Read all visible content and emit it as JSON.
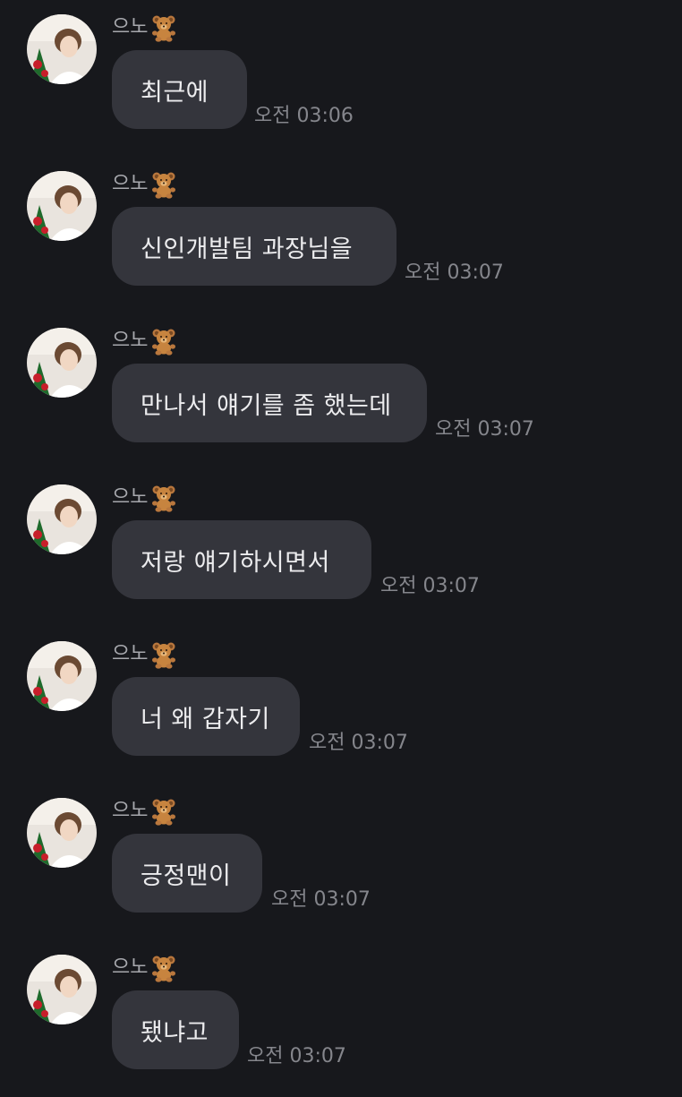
{
  "chat": {
    "sender_name": "으노",
    "sender_emoji_icon": "teddy-bear-icon",
    "avatar": "profile-photo",
    "colors": {
      "background": "#17181c",
      "bubble": "#34353c",
      "text": "#ececee",
      "meta": "#85868c"
    },
    "messages": [
      {
        "text": "최근에",
        "time": "오전 03:06"
      },
      {
        "text": "신인개발팀 과장님을",
        "time": "오전 03:07"
      },
      {
        "text": "만나서 얘기를 좀 했는데",
        "time": "오전 03:07"
      },
      {
        "text": "저랑 얘기하시면서",
        "time": "오전 03:07"
      },
      {
        "text": "너 왜 갑자기",
        "time": "오전 03:07"
      },
      {
        "text": "긍정맨이",
        "time": "오전 03:07"
      },
      {
        "text": "됐냐고",
        "time": "오전 03:07"
      }
    ]
  }
}
